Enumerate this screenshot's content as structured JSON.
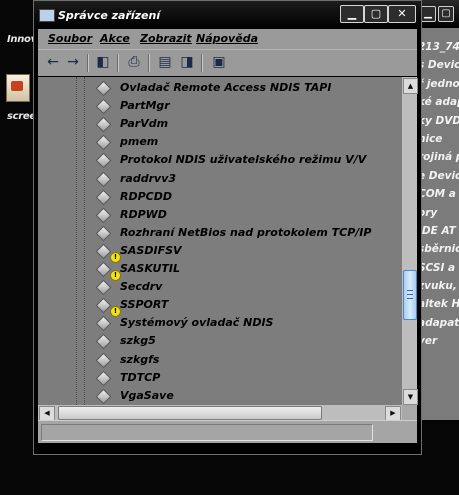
{
  "desktop": {
    "icons": [
      {
        "label": "Innov",
        "icon": "app-icon"
      },
      {
        "label": "scree",
        "icon": "document-icon"
      }
    ]
  },
  "background_window": {
    "lines": [
      "213_74",
      "s Device",
      "ř jedno",
      "ké adapt",
      "ky DVD",
      "nice",
      "rojiná pol",
      "e Device",
      "COM a",
      "ory",
      "IDE AT",
      "sběrnic",
      "SCSI a",
      "zvuku,",
      "altek Hi",
      "adapat",
      "ver"
    ]
  },
  "window": {
    "title": "Správce zařízení",
    "controls": {
      "minimize": "▁",
      "maximize": "▢",
      "close": "✕"
    },
    "menu": [
      {
        "label": "Soubor"
      },
      {
        "label": "Akce"
      },
      {
        "label": "Zobrazit"
      },
      {
        "label": "Nápověda"
      }
    ],
    "toolbar": {
      "icons": [
        "back-arrow-icon",
        "forward-arrow-icon",
        "show-hide-tree-icon",
        "print-icon",
        "properties-icon",
        "help-icon",
        "scan-hardware-icon"
      ]
    },
    "tree_items": [
      {
        "label": "Ovladač Remote Access NDIS TAPI",
        "warning": false
      },
      {
        "label": "PartMgr",
        "warning": false
      },
      {
        "label": "ParVdm",
        "warning": false
      },
      {
        "label": "pmem",
        "warning": false
      },
      {
        "label": "Protokol NDIS uživatelského režimu V/V",
        "warning": false
      },
      {
        "label": "raddrvv3",
        "warning": false
      },
      {
        "label": "RDPCDD",
        "warning": false
      },
      {
        "label": "RDPWD",
        "warning": false
      },
      {
        "label": "Rozhraní NetBios nad protokolem TCP/IP",
        "warning": false
      },
      {
        "label": "SASDIFSV",
        "warning": true
      },
      {
        "label": "SASKUTIL",
        "warning": true
      },
      {
        "label": "Secdrv",
        "warning": false
      },
      {
        "label": "SSPORT",
        "warning": true
      },
      {
        "label": "Systémový ovladač NDIS",
        "warning": false
      },
      {
        "label": "szkg5",
        "warning": false
      },
      {
        "label": "szkgfs",
        "warning": false
      },
      {
        "label": "TDTCP",
        "warning": false
      },
      {
        "label": "VgaSave",
        "warning": false
      }
    ],
    "scroll": {
      "vertical_position": 0.72,
      "horizontal_position": 0.05
    },
    "colors": {
      "tree_bg": "#7d7d7d",
      "warning": "#f0e020",
      "scroll_thumb": "#a8cdf0"
    }
  }
}
